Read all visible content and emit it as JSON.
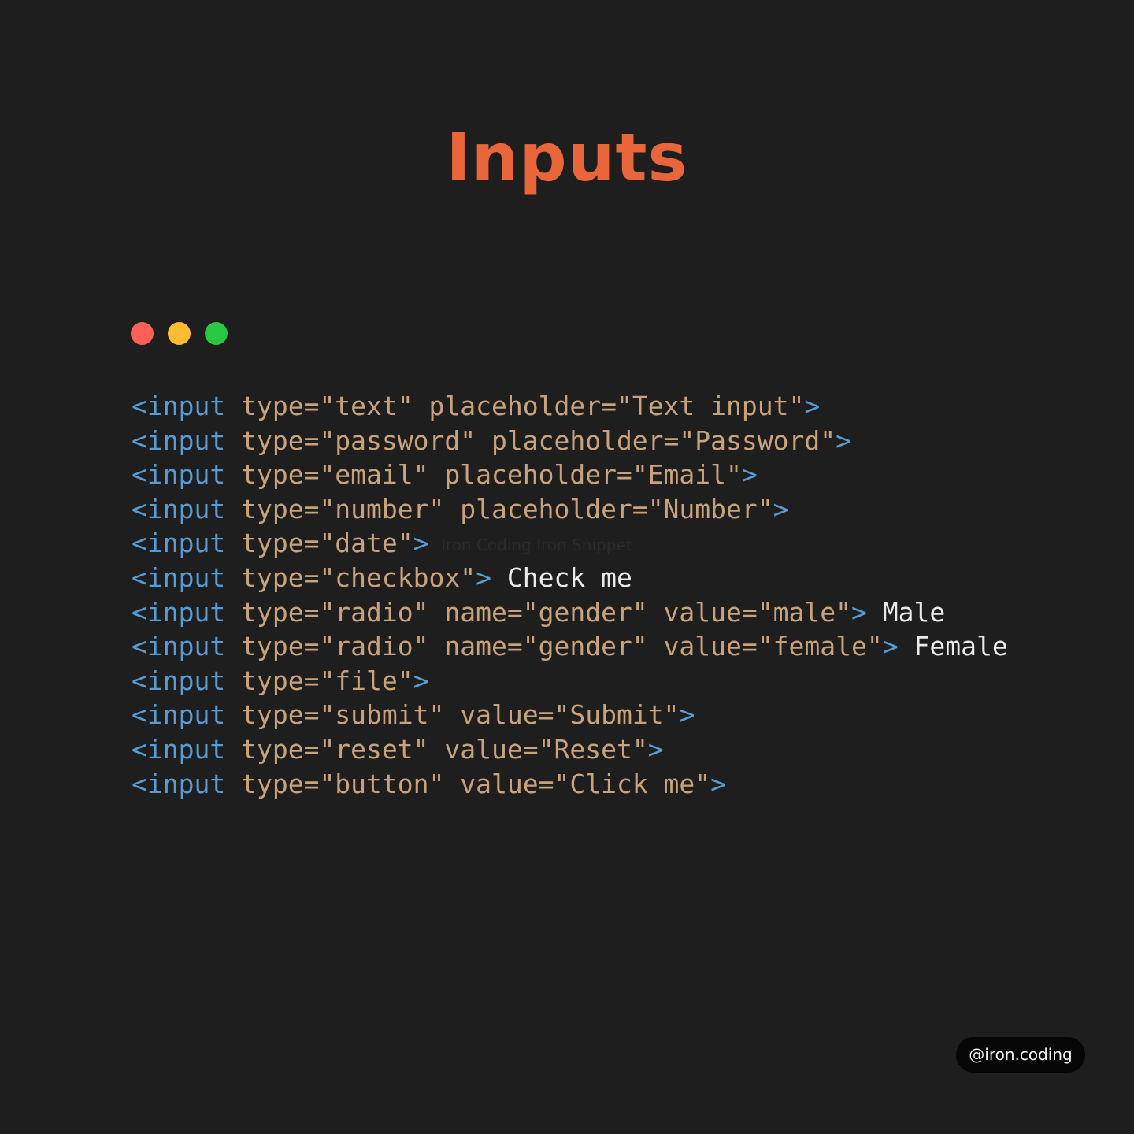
{
  "title": "Inputs",
  "window": {
    "dots": [
      {
        "name": "close",
        "color": "#ff5f57"
      },
      {
        "name": "minimize",
        "color": "#febc2e"
      },
      {
        "name": "maximize",
        "color": "#28c840"
      }
    ]
  },
  "colors": {
    "background": "#1e1e1e",
    "title": "#e9663a",
    "tag": "#569cd6",
    "attribute": "#c8a27a",
    "text": "#eaeaea"
  },
  "code": {
    "lines": [
      {
        "tag": "input",
        "attrs": [
          {
            "name": "type",
            "value": "text"
          },
          {
            "name": "placeholder",
            "value": "Text input"
          }
        ],
        "after": ""
      },
      {
        "tag": "input",
        "attrs": [
          {
            "name": "type",
            "value": "password"
          },
          {
            "name": "placeholder",
            "value": "Password"
          }
        ],
        "after": ""
      },
      {
        "tag": "input",
        "attrs": [
          {
            "name": "type",
            "value": "email"
          },
          {
            "name": "placeholder",
            "value": "Email"
          }
        ],
        "after": ""
      },
      {
        "tag": "input",
        "attrs": [
          {
            "name": "type",
            "value": "number"
          },
          {
            "name": "placeholder",
            "value": "Number"
          }
        ],
        "after": ""
      },
      {
        "tag": "input",
        "attrs": [
          {
            "name": "type",
            "value": "date"
          }
        ],
        "after": ""
      },
      {
        "tag": "input",
        "attrs": [
          {
            "name": "type",
            "value": "checkbox"
          }
        ],
        "after": "Check me"
      },
      {
        "tag": "input",
        "attrs": [
          {
            "name": "type",
            "value": "radio"
          },
          {
            "name": "name",
            "value": "gender"
          },
          {
            "name": "value",
            "value": "male"
          }
        ],
        "after": "Male"
      },
      {
        "tag": "input",
        "attrs": [
          {
            "name": "type",
            "value": "radio"
          },
          {
            "name": "name",
            "value": "gender"
          },
          {
            "name": "value",
            "value": "female"
          }
        ],
        "after": "Female"
      },
      {
        "tag": "input",
        "attrs": [
          {
            "name": "type",
            "value": "file"
          }
        ],
        "after": ""
      },
      {
        "tag": "input",
        "attrs": [
          {
            "name": "type",
            "value": "submit"
          },
          {
            "name": "value",
            "value": "Submit"
          }
        ],
        "after": ""
      },
      {
        "tag": "input",
        "attrs": [
          {
            "name": "type",
            "value": "reset"
          },
          {
            "name": "value",
            "value": "Reset"
          }
        ],
        "after": ""
      },
      {
        "tag": "input",
        "attrs": [
          {
            "name": "type",
            "value": "button"
          },
          {
            "name": "value",
            "value": "Click me"
          }
        ],
        "after": ""
      }
    ]
  },
  "watermark": "Iron Coding   Iron Snippet",
  "handle": "@iron.coding"
}
